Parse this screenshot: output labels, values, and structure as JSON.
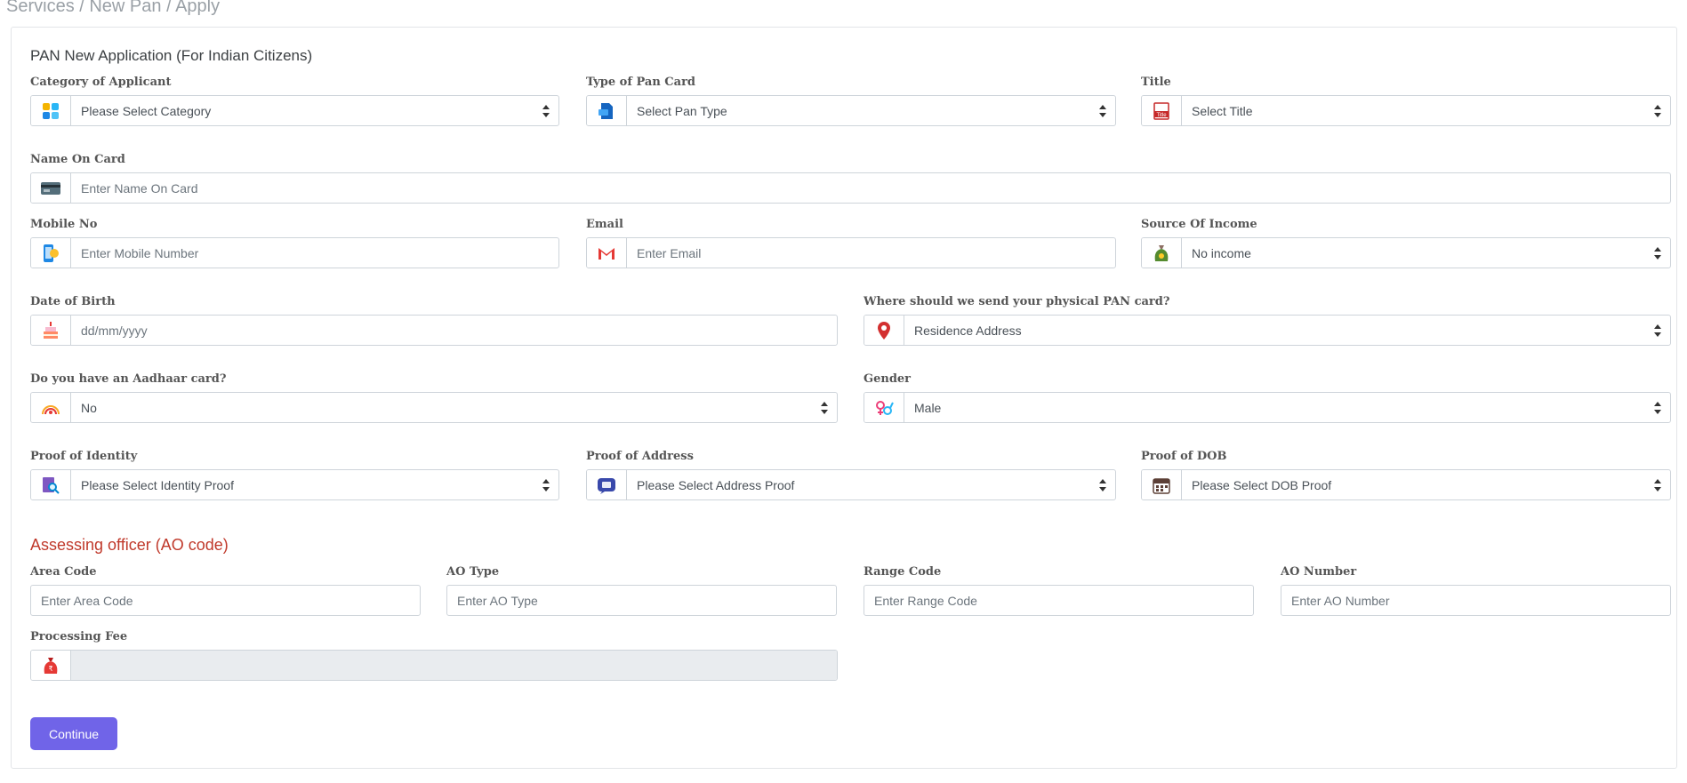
{
  "breadcrumb": "Services / New Pan / Apply",
  "form": {
    "title": "PAN New Application (For Indian Citizens)",
    "category": {
      "label": "Category of Applicant",
      "value": "Please Select Category"
    },
    "pan_type": {
      "label": "Type of Pan Card",
      "value": "Select Pan Type"
    },
    "title_field": {
      "label": "Title",
      "value": "Select Title",
      "icon_text": "Title"
    },
    "name_on_card": {
      "label": "Name On Card",
      "placeholder": "Enter Name On Card"
    },
    "mobile": {
      "label": "Mobile No",
      "placeholder": "Enter Mobile Number"
    },
    "email": {
      "label": "Email",
      "placeholder": "Enter Email"
    },
    "income": {
      "label": "Source Of Income",
      "value": "No income"
    },
    "dob": {
      "label": "Date of Birth",
      "placeholder": "dd/mm/yyyy"
    },
    "send_to": {
      "label": "Where should we send your physical PAN card?",
      "value": "Residence Address"
    },
    "aadhaar": {
      "label": "Do you have an Aadhaar card?",
      "value": "No"
    },
    "gender": {
      "label": "Gender",
      "value": "Male"
    },
    "poi": {
      "label": "Proof of Identity",
      "value": "Please Select Identity Proof"
    },
    "poa": {
      "label": "Proof of Address",
      "value": "Please Select Address Proof"
    },
    "podob": {
      "label": "Proof of DOB",
      "value": "Please Select DOB Proof"
    }
  },
  "ao": {
    "title": "Assessing officer (AO code)",
    "area_code": {
      "label": "Area Code",
      "placeholder": "Enter Area Code"
    },
    "ao_type": {
      "label": "AO Type",
      "placeholder": "Enter AO Type"
    },
    "range_code": {
      "label": "Range Code",
      "placeholder": "Enter Range Code"
    },
    "ao_number": {
      "label": "AO Number",
      "placeholder": "Enter AO Number"
    }
  },
  "fee": {
    "label": "Processing Fee",
    "value": "",
    "icon_text": "₹"
  },
  "continue_label": "Continue",
  "colors": {
    "accent": "#7064e8",
    "section_title": "#c0392b",
    "border": "#ced4da"
  }
}
